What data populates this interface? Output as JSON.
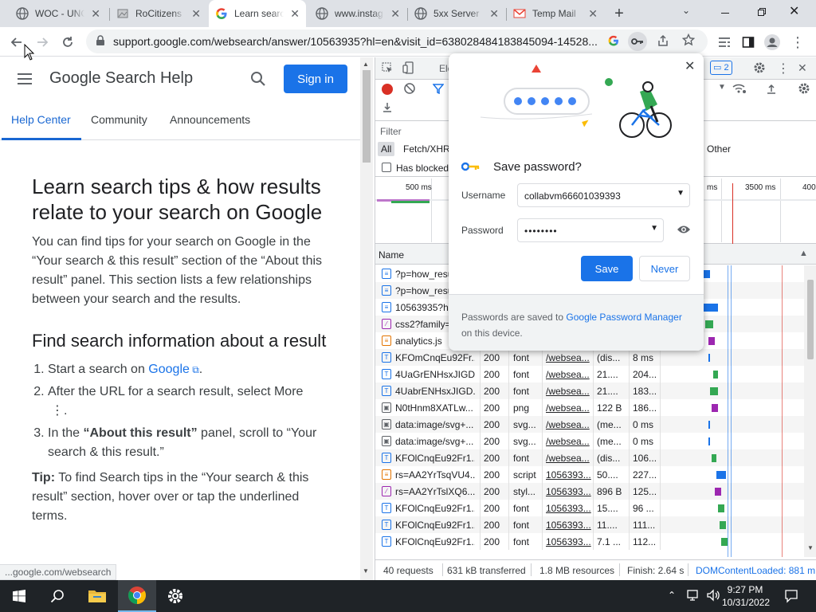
{
  "tabs": [
    {
      "title": "WOC - UNC"
    },
    {
      "title": "RoCitizens"
    },
    {
      "title": "Learn search"
    },
    {
      "title": "www.instag"
    },
    {
      "title": "5xx Server"
    },
    {
      "title": "Temp Mail"
    }
  ],
  "omnibox": {
    "url": "support.google.com/websearch/answer/10563935?hl=en&visit_id=638028484183845094-14528..."
  },
  "page": {
    "brand": "Google Search Help",
    "sign_in": "Sign in",
    "nav": [
      "Help Center",
      "Community",
      "Announcements"
    ],
    "title": "Learn search tips & how results relate to your search on Google",
    "intro": "You can find tips for your search on Google in the “Your search & this result” section of the “About this result” panel. This section lists a few relationships between your search and the results.",
    "h2": "Find search information about a result",
    "step1_prefix": "Start a search on ",
    "step1_link": "Google",
    "step1_suffix": ".",
    "step2": "After the URL for a search result, select More",
    "step2_suffix": ".",
    "step3_prefix": "In the ",
    "step3_bold": "“About this result”",
    "step3_suffix": " panel, scroll to “Your search & this result.”",
    "tip_label": "Tip:",
    "tip_text": " To find Search tips in the “Your search & this result” section, hover over or tap the underlined terms.",
    "status": "...google.com/websearch"
  },
  "devtools": {
    "tab_partial": "Ele",
    "badge": "2",
    "filter_label": "Filter",
    "type_all": "All",
    "type_fetch": "Fetch/XHR",
    "type_other": "Other",
    "has_blocked": "Has blocked",
    "timeline": [
      "500 ms",
      "ms",
      "3500 ms",
      "400"
    ],
    "name_header": "Name",
    "rows": [
      {
        "name": "?p=how_resu",
        "status": "",
        "type": "",
        "initiator": "",
        "size": "",
        "time": ""
      },
      {
        "name": "?p=how_resu",
        "status": "",
        "type": "",
        "initiator": "",
        "size": "",
        "time": ""
      },
      {
        "name": "10563935?hl",
        "status": "",
        "type": "",
        "initiator": "",
        "size": "",
        "time": ""
      },
      {
        "name": "css2?family=",
        "status": "",
        "type": "",
        "initiator": "",
        "size": "",
        "time": ""
      },
      {
        "name": "analytics.js",
        "status": "",
        "type": "",
        "initiator": "",
        "size": "",
        "time": ""
      },
      {
        "name": "KFOmCnqEu92Fr...",
        "status": "200",
        "type": "font",
        "initiator": "/webseа...",
        "size": "(dis...",
        "time": "8 ms"
      },
      {
        "name": "4UaGrENHsxJIGD...",
        "status": "200",
        "type": "font",
        "initiator": "/webseа...",
        "size": "21....",
        "time": "204..."
      },
      {
        "name": "4UabrENHsxJIGD...",
        "status": "200",
        "type": "font",
        "initiator": "/webseа...",
        "size": "21....",
        "time": "183..."
      },
      {
        "name": "N0tHnm8XATLw...",
        "status": "200",
        "type": "png",
        "initiator": "/webseа...",
        "size": "122 B",
        "time": "186..."
      },
      {
        "name": "data:image/svg+...",
        "status": "200",
        "type": "svg...",
        "initiator": "/webseа...",
        "size": "(me...",
        "time": "0 ms"
      },
      {
        "name": "data:image/svg+...",
        "status": "200",
        "type": "svg...",
        "initiator": "/webseа...",
        "size": "(me...",
        "time": "0 ms"
      },
      {
        "name": "KFOlCnqEu92Fr1...",
        "status": "200",
        "type": "font",
        "initiator": "/webseа...",
        "size": "(dis...",
        "time": "106..."
      },
      {
        "name": "rs=AA2YrTsqVU4...",
        "status": "200",
        "type": "script",
        "initiator": "1056393...",
        "size": "50....",
        "time": "227..."
      },
      {
        "name": "rs=AA2YrTslXQ6...",
        "status": "200",
        "type": "styl...",
        "initiator": "1056393...",
        "size": "896 B",
        "time": "125..."
      },
      {
        "name": "KFOlCnqEu92Fr1...",
        "status": "200",
        "type": "font",
        "initiator": "1056393...",
        "size": "15....",
        "time": "96 ..."
      },
      {
        "name": "KFOlCnqEu92Fr1...",
        "status": "200",
        "type": "font",
        "initiator": "1056393...",
        "size": "11....",
        "time": "111..."
      },
      {
        "name": "KFOlCnqEu92Fr1...",
        "status": "200",
        "type": "font",
        "initiator": "1056393...",
        "size": "7.1 ...",
        "time": "112..."
      }
    ],
    "summary": {
      "requests": "40 requests",
      "transferred": "631 kB transferred",
      "resources": "1.8 MB resources",
      "finish": "Finish: 2.64 s",
      "dcl": "DOMContentLoaded: 881 m"
    }
  },
  "popup": {
    "title": "Save password?",
    "username_label": "Username",
    "username_value": "collabvm66601039393",
    "password_label": "Password",
    "password_value": "••••••••",
    "save": "Save",
    "never": "Never",
    "footer_prefix": "Passwords are saved to ",
    "footer_link": "Google Password Manager",
    "footer_suffix": " on this device."
  },
  "taskbar": {
    "time": "9:27 PM",
    "date": "10/31/2022"
  },
  "colors": {
    "accent": "#1a73e8",
    "taskbar": "#1f2327"
  }
}
